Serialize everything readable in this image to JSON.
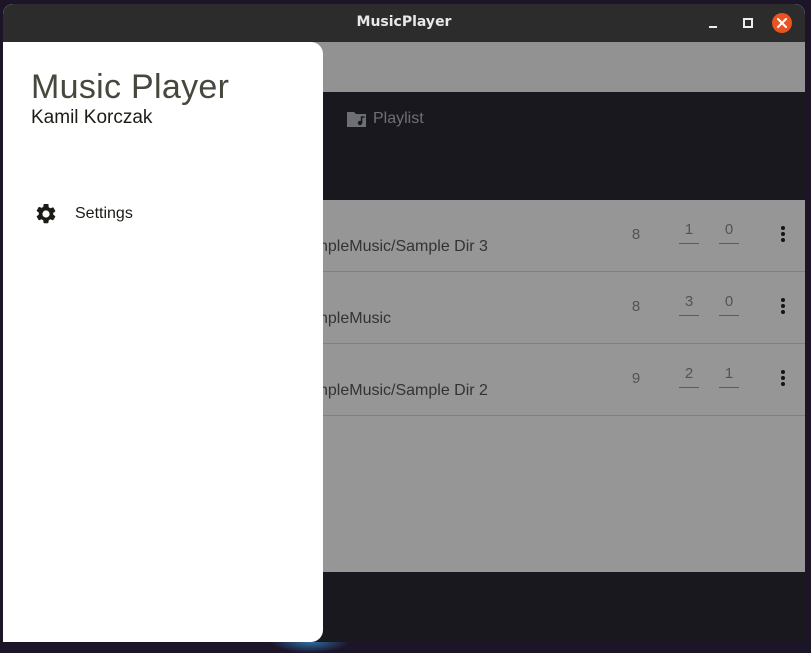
{
  "window": {
    "title": "MusicPlayer",
    "controls": [
      "minimize-icon",
      "maximize-icon",
      "close-icon"
    ],
    "close_color": "#e95420"
  },
  "tabs": [
    {
      "label": "Playlist",
      "icon": "folder-music-icon"
    }
  ],
  "folders": [
    {
      "path_visible": "nplеMusic/Sample Dir 3",
      "count": "8",
      "value_a": "1",
      "value_b": "0"
    },
    {
      "path_visible": "nplеMusic",
      "count": "8",
      "value_a": "3",
      "value_b": "0"
    },
    {
      "path_visible": "nplеMusic/Sample Dir 2",
      "count": "9",
      "value_a": "2",
      "value_b": "1"
    }
  ],
  "drawer": {
    "title": "Music Player",
    "subtitle": "Kamil Korczak",
    "items": [
      {
        "label": "Settings",
        "icon": "gear-icon"
      }
    ]
  },
  "colors": {
    "titlebar": "#2c2c2c",
    "tabbar": "#2b2935",
    "drawer_title": "#47473d"
  }
}
